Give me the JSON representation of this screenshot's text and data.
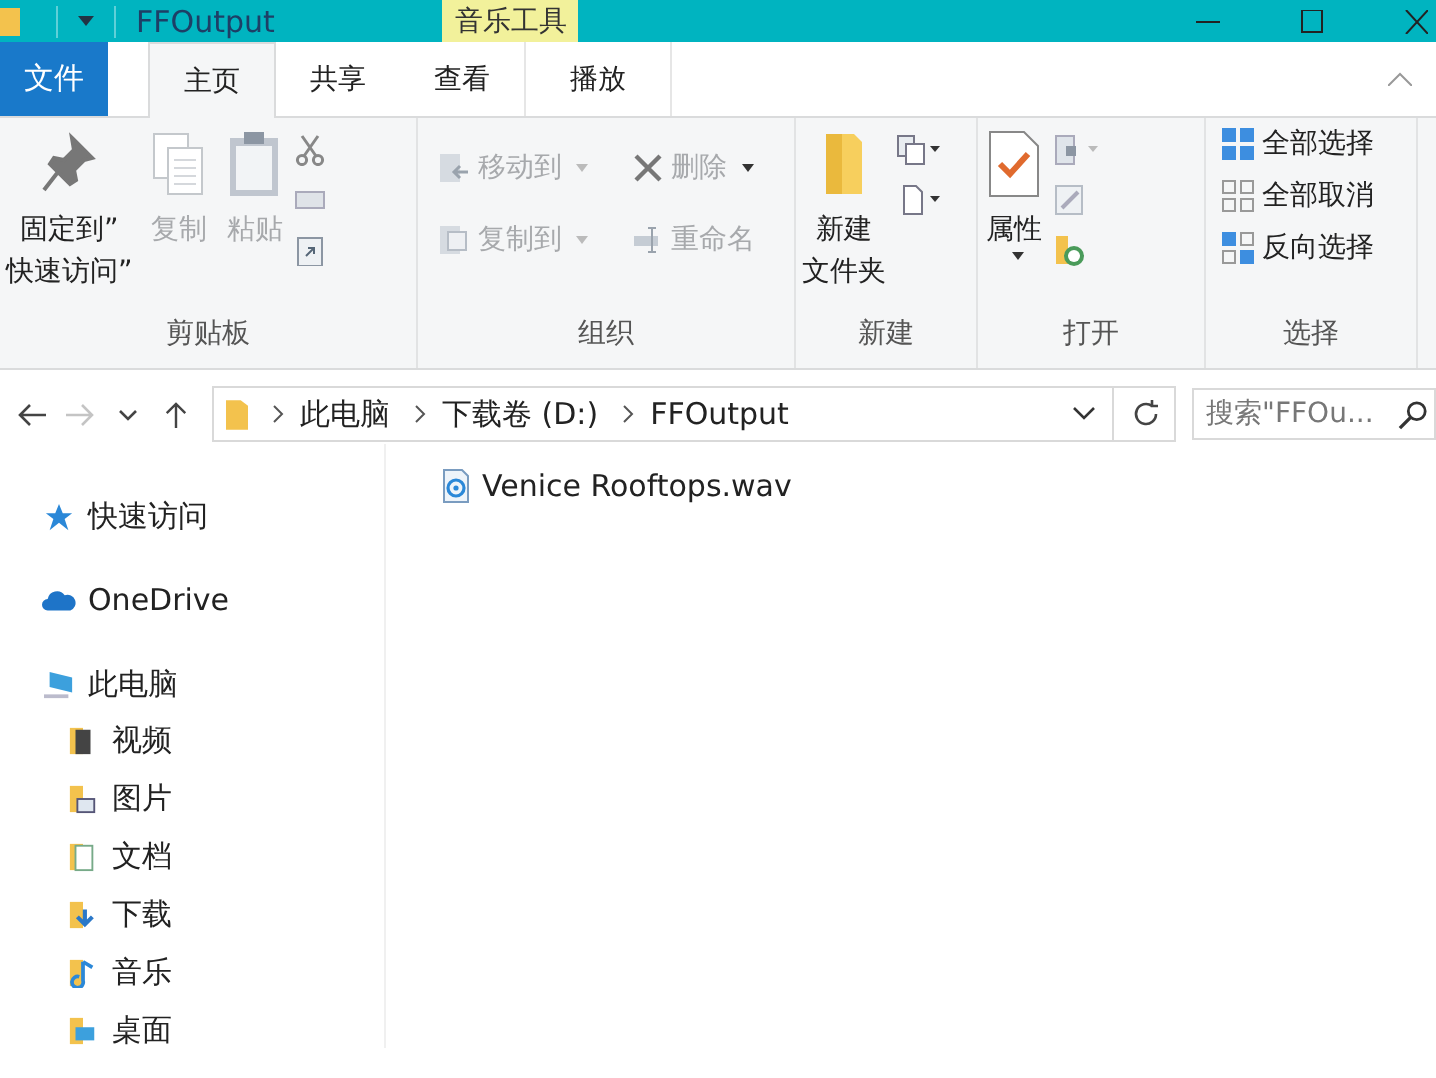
{
  "window": {
    "title": "FFOutput",
    "context_header": "音乐工具"
  },
  "tabs": [
    {
      "label": "文件",
      "kind": "file",
      "selected": false
    },
    {
      "label": "主页",
      "kind": "normal",
      "selected": true
    },
    {
      "label": "共享",
      "kind": "normal",
      "selected": false
    },
    {
      "label": "查看",
      "kind": "normal",
      "selected": false
    },
    {
      "label": "播放",
      "kind": "context",
      "selected": false
    }
  ],
  "ribbon": {
    "clipboard": {
      "label": "剪贴板",
      "pin": {
        "label_lines": [
          "固定到”",
          "快速访问”"
        ],
        "disabled": false
      },
      "copy": {
        "label": "复制",
        "disabled": true
      },
      "paste": {
        "label": "粘贴",
        "disabled": true
      }
    },
    "organize": {
      "label": "组织",
      "move_to": {
        "label": "移动到",
        "disabled": true
      },
      "copy_to": {
        "label": "复制到",
        "disabled": true
      },
      "delete": {
        "label": "删除",
        "disabled": true
      },
      "rename": {
        "label": "重命名",
        "disabled": true
      }
    },
    "new": {
      "label": "新建",
      "new_folder": {
        "label_lines": [
          "新建",
          "文件夹"
        ],
        "disabled": false
      }
    },
    "open": {
      "label": "打开",
      "properties": {
        "label": "属性",
        "disabled": false
      }
    },
    "select": {
      "label": "选择",
      "select_all": {
        "label": "全部选择",
        "disabled": false
      },
      "select_none": {
        "label": "全部取消",
        "disabled": false
      },
      "invert": {
        "label": "反向选择",
        "disabled": false
      }
    }
  },
  "nav_buttons": [
    {
      "kind": "back",
      "disabled": false
    },
    {
      "kind": "forward",
      "disabled": true
    },
    {
      "kind": "recent",
      "disabled": false
    },
    {
      "kind": "up",
      "disabled": false
    }
  ],
  "address": {
    "segments": [
      "此电脑",
      "下载卷 (D:)",
      "FFOutput"
    ]
  },
  "search": {
    "placeholder": "搜索\"FFOu..."
  },
  "sidebar": {
    "items": [
      {
        "label": "快速访问",
        "kind": "quick"
      },
      {
        "label": "OneDrive",
        "kind": "cloud"
      },
      {
        "label": "此电脑",
        "kind": "pc",
        "children": [
          {
            "label": "视频",
            "kind": "videos"
          },
          {
            "label": "图片",
            "kind": "pictures"
          },
          {
            "label": "文档",
            "kind": "documents"
          },
          {
            "label": "下载",
            "kind": "downloads"
          },
          {
            "label": "音乐",
            "kind": "music"
          },
          {
            "label": "桌面",
            "kind": "desktop"
          }
        ]
      }
    ]
  },
  "files": [
    {
      "name": "Venice Rooftops.wav"
    }
  ]
}
